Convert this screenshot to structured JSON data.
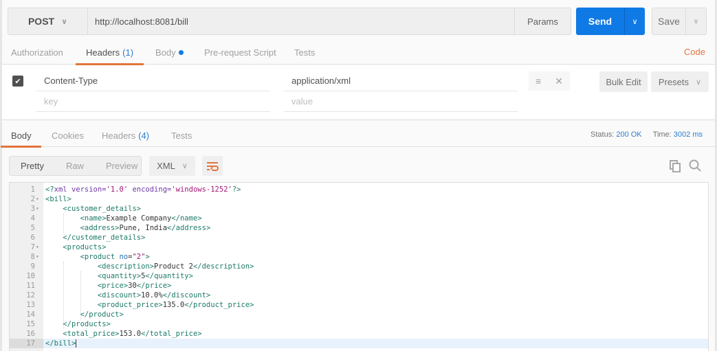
{
  "request": {
    "method": "POST",
    "url": "http://localhost:8081/bill",
    "params_label": "Params",
    "send_label": "Send",
    "save_label": "Save",
    "tabs": [
      {
        "label": "Authorization",
        "count": null,
        "active": false
      },
      {
        "label": "Headers",
        "count": "(1)",
        "active": true
      },
      {
        "label": "Body",
        "count": null,
        "active": false,
        "modified_dot": true
      },
      {
        "label": "Pre-request Script",
        "count": null,
        "active": false
      },
      {
        "label": "Tests",
        "count": null,
        "active": false
      }
    ],
    "code_link": "Code",
    "headers": [
      {
        "enabled": true,
        "key": "Content-Type",
        "value": "application/xml"
      }
    ],
    "new_header": {
      "key_placeholder": "key",
      "value_placeholder": "value"
    },
    "bulk_edit_label": "Bulk Edit",
    "presets_label": "Presets"
  },
  "response": {
    "tabs": [
      {
        "label": "Body",
        "count": null,
        "active": true
      },
      {
        "label": "Cookies",
        "count": null,
        "active": false
      },
      {
        "label": "Headers",
        "count": "(4)",
        "active": false
      },
      {
        "label": "Tests",
        "count": null,
        "active": false
      }
    ],
    "status_label": "Status:",
    "status_value": "200 OK",
    "time_label": "Time:",
    "time_value": "3002 ms",
    "view_modes": [
      "Pretty",
      "Raw",
      "Preview"
    ],
    "active_view": "Pretty",
    "format": "XML",
    "body_lines": [
      {
        "n": "1",
        "fold": false,
        "text": "<?xml version='1.0' encoding='windows-1252'?>"
      },
      {
        "n": "2",
        "fold": true,
        "text": "<bill>"
      },
      {
        "n": "3",
        "fold": true,
        "text": "    <customer_details>"
      },
      {
        "n": "4",
        "fold": false,
        "text": "        <name>Example Company</name>"
      },
      {
        "n": "5",
        "fold": false,
        "text": "        <address>Pune, India</address>"
      },
      {
        "n": "6",
        "fold": false,
        "text": "    </customer_details>"
      },
      {
        "n": "7",
        "fold": true,
        "text": "    <products>"
      },
      {
        "n": "8",
        "fold": true,
        "text": "        <product no=\"2\">"
      },
      {
        "n": "9",
        "fold": false,
        "text": "            <description>Product 2</description>"
      },
      {
        "n": "10",
        "fold": false,
        "text": "            <quantity>5</quantity>"
      },
      {
        "n": "11",
        "fold": false,
        "text": "            <price>30</price>"
      },
      {
        "n": "12",
        "fold": false,
        "text": "            <discount>10.0%</discount>"
      },
      {
        "n": "13",
        "fold": false,
        "text": "            <product_price>135.0</product_price>"
      },
      {
        "n": "14",
        "fold": false,
        "text": "        </product>"
      },
      {
        "n": "15",
        "fold": false,
        "text": "    </products>"
      },
      {
        "n": "16",
        "fold": false,
        "text": "    <total_price>153.0</total_price>"
      },
      {
        "n": "17",
        "fold": false,
        "text": "</bill>",
        "current": true
      }
    ]
  },
  "icons": {
    "method_caret": "chevron-down",
    "send_caret": "chevron-down",
    "save_caret": "chevron-down",
    "header_checkbox": "check",
    "row_menu": "hamburger",
    "row_delete": "close",
    "presets_caret": "chevron-down",
    "format_caret": "chevron-down",
    "wrap": "wrap-lines",
    "copy": "copy",
    "search": "magnifier"
  },
  "colors": {
    "accent": "#e3743b",
    "send": "#0f7ae5",
    "link": "#2d7cd1"
  }
}
